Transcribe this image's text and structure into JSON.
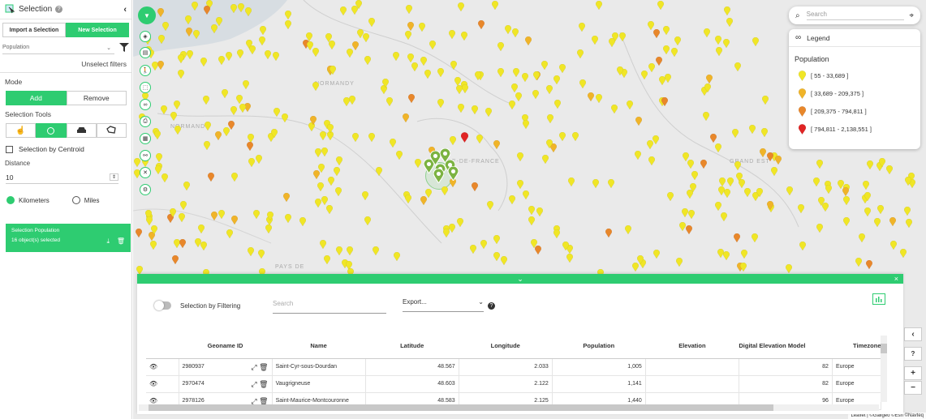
{
  "sidebar": {
    "title": "Selection",
    "tabs": [
      "Import a Selection",
      "New Selection"
    ],
    "filter_field": "Population",
    "unselect_filters": "Unselect filters",
    "mode_label": "Mode",
    "mode_options": [
      "Add",
      "Remove"
    ],
    "tools_label": "Selection Tools",
    "centroid_label": "Selection by Centroid",
    "distance_label": "Distance",
    "distance_value": "10",
    "unit_km": "Kilometers",
    "unit_miles": "Miles",
    "selection_card": {
      "title": "Selection Population",
      "count": "16 object(s) selected"
    }
  },
  "map": {
    "search_placeholder": "Search",
    "labels": [
      "NORMANDY",
      "NORMANDY",
      "ÎLE-DE-FRANCE",
      "GRAND EST",
      "PAYS DE"
    ],
    "legend": {
      "title": "Legend",
      "field": "Population",
      "classes": [
        {
          "range": "[ 55 - 33,689 ]",
          "color": "#f0e626"
        },
        {
          "range": "[ 33,689 - 209,375 ]",
          "color": "#f0b429"
        },
        {
          "range": "[ 209,375 - 794,811 ]",
          "color": "#e8872b"
        },
        {
          "range": "[ 794,811 - 2,138,551 ]",
          "color": "#e02424"
        }
      ]
    },
    "attribution": "Leaflet | ©Galigeo ©Esri ©Navteq",
    "zoom_in": "+",
    "zoom_out": "−",
    "help": "?"
  },
  "panel": {
    "filter_toggle_label": "Selection by Filtering",
    "search_placeholder": "Search",
    "export_label": "Export...",
    "columns": [
      "Geoname ID",
      "Name",
      "Latitude",
      "Longitude",
      "Population",
      "Elevation",
      "Digital Elevation Model",
      "Timezone"
    ],
    "rows": [
      {
        "id": "2980937",
        "name": "Saint-Cyr-sous-Dourdan",
        "lat": "48.567",
        "lon": "2.033",
        "pop": "1,005",
        "elev": "",
        "dem": "82",
        "tz": "Europe"
      },
      {
        "id": "2970474",
        "name": "Vaugrigneuse",
        "lat": "48.603",
        "lon": "2.122",
        "pop": "1,141",
        "elev": "",
        "dem": "82",
        "tz": "Europe"
      },
      {
        "id": "2978126",
        "name": "Saint-Maurice-Montcouronne",
        "lat": "48.583",
        "lon": "2.125",
        "pop": "1,440",
        "elev": "",
        "dem": "96",
        "tz": "Europe"
      }
    ]
  }
}
